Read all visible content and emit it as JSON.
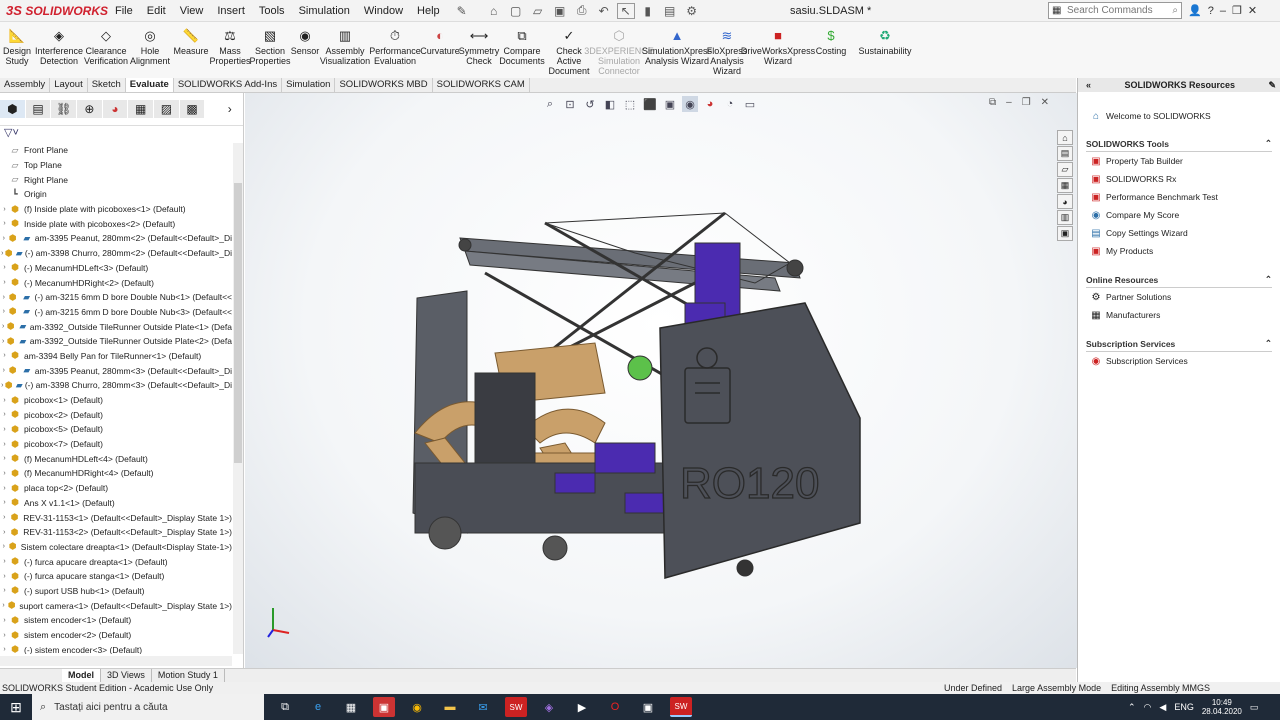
{
  "app": {
    "brand": "SOLIDWORKS",
    "menus": [
      "File",
      "Edit",
      "View",
      "Insert",
      "Tools",
      "Simulation",
      "Window",
      "Help"
    ],
    "doc_title": "sasiu.SLDASM *",
    "search_placeholder": "Search Commands",
    "help_label": "?"
  },
  "commands": [
    {
      "label": "Design Study",
      "icon": "design-study-icon"
    },
    {
      "label": "Interference Detection",
      "icon": "interference-icon"
    },
    {
      "label": "Clearance Verification",
      "icon": "clearance-icon"
    },
    {
      "label": "Hole Alignment",
      "icon": "hole-alignment-icon"
    },
    {
      "label": "Measure",
      "icon": "measure-icon"
    },
    {
      "label": "Mass Properties",
      "icon": "mass-properties-icon"
    },
    {
      "label": "Section Properties",
      "icon": "section-properties-icon"
    },
    {
      "label": "Sensor",
      "icon": "sensor-icon"
    },
    {
      "label": "Assembly Visualization",
      "icon": "assembly-visualization-icon"
    },
    {
      "label": "Performance Evaluation",
      "icon": "performance-icon"
    },
    {
      "label": "Curvature",
      "icon": "curvature-icon"
    },
    {
      "label": "Symmetry Check",
      "icon": "symmetry-icon"
    },
    {
      "label": "Compare Documents",
      "icon": "compare-icon"
    },
    {
      "label": "Check Active Document",
      "icon": "check-icon"
    },
    {
      "label": "3DEXPERIENCE Simulation Connector",
      "icon": "connector-icon",
      "disabled": true
    },
    {
      "label": "SimulationXpress Analysis Wizard",
      "icon": "simxpress-icon"
    },
    {
      "label": "FloXpress Analysis Wizard",
      "icon": "floxpress-icon"
    },
    {
      "label": "DriveWorksXpress Wizard",
      "icon": "driveworks-icon"
    },
    {
      "label": "Costing",
      "icon": "costing-icon"
    },
    {
      "label": "Sustainability",
      "icon": "sustainability-icon"
    }
  ],
  "cmd_tabs": [
    "Assembly",
    "Layout",
    "Sketch",
    "Evaluate",
    "SOLIDWORKS Add-Ins",
    "Simulation",
    "SOLIDWORKS MBD",
    "SOLIDWORKS CAM"
  ],
  "active_cmd_tab": "Evaluate",
  "tree": [
    {
      "label": "Front Plane",
      "type": "plane"
    },
    {
      "label": "Top Plane",
      "type": "plane"
    },
    {
      "label": "Right Plane",
      "type": "plane"
    },
    {
      "label": "Origin",
      "type": "origin"
    },
    {
      "label": "(f) Inside plate with picoboxes<1> (Default)",
      "type": "asm"
    },
    {
      "label": "Inside plate with picoboxes<2> (Default)",
      "type": "asm"
    },
    {
      "label": "am-3395 Peanut, 280mm<2> (Default<<Default>_Di",
      "type": "asm-part"
    },
    {
      "label": "(-) am-3398 Churro, 280mm<2> (Default<<Default>_Di",
      "type": "asm-part"
    },
    {
      "label": "(-) MecanumHDLeft<3> (Default)",
      "type": "asm"
    },
    {
      "label": "(-) MecanumHDRight<2> (Default)",
      "type": "asm"
    },
    {
      "label": "(-) am-3215 6mm D bore Double Nub<1> (Default<<",
      "type": "asm-part"
    },
    {
      "label": "(-) am-3215 6mm D bore Double Nub<3> (Default<<",
      "type": "asm-part"
    },
    {
      "label": "am-3392_Outside TileRunner Outside Plate<1> (Defa",
      "type": "asm-part"
    },
    {
      "label": "am-3392_Outside TileRunner Outside Plate<2> (Defa",
      "type": "asm-part"
    },
    {
      "label": "am-3394 Belly Pan for TileRunner<1> (Default)",
      "type": "asm"
    },
    {
      "label": "am-3395 Peanut, 280mm<3> (Default<<Default>_Di",
      "type": "asm-part"
    },
    {
      "label": "(-) am-3398 Churro, 280mm<3> (Default<<Default>_Di",
      "type": "asm-part"
    },
    {
      "label": "picobox<1> (Default)",
      "type": "asm"
    },
    {
      "label": "picobox<2> (Default)",
      "type": "asm"
    },
    {
      "label": "picobox<5> (Default)",
      "type": "asm"
    },
    {
      "label": "picobox<7> (Default)",
      "type": "asm"
    },
    {
      "label": "(f) MecanumHDLeft<4> (Default)",
      "type": "asm"
    },
    {
      "label": "(f) MecanumHDRight<4> (Default)",
      "type": "asm"
    },
    {
      "label": "placa top<2> (Default)",
      "type": "asm"
    },
    {
      "label": "Ans X v1.1<1> (Default)",
      "type": "asm"
    },
    {
      "label": "REV-31-1153<1> (Default<<Default>_Display State 1>)",
      "type": "asm"
    },
    {
      "label": "REV-31-1153<2> (Default<<Default>_Display State 1>)",
      "type": "asm"
    },
    {
      "label": "Sistem colectare dreapta<1> (Default<Display State-1>)",
      "type": "asm"
    },
    {
      "label": "(-) furca apucare dreapta<1> (Default)",
      "type": "asm"
    },
    {
      "label": "(-) furca apucare stanga<1> (Default)",
      "type": "asm"
    },
    {
      "label": "(-) suport USB hub<1> (Default)",
      "type": "asm"
    },
    {
      "label": "suport camera<1> (Default<<Default>_Display State 1>)",
      "type": "asm"
    },
    {
      "label": "sistem encoder<1> (Default)",
      "type": "asm"
    },
    {
      "label": "sistem encoder<2> (Default)",
      "type": "asm"
    },
    {
      "label": "(-) sistem encoder<3> (Default)",
      "type": "asm"
    }
  ],
  "bottom_tabs": [
    "Model",
    "3D Views",
    "Motion Study 1"
  ],
  "active_bottom_tab": "Model",
  "status": {
    "edition": "SOLIDWORKS Student Edition - Academic Use Only",
    "under_defined": "Under Defined",
    "mode": "Large Assembly Mode",
    "editing": "Editing Assembly",
    "units": "MMGS"
  },
  "robot_label": "RO120",
  "taskpane": {
    "title": "SOLIDWORKS Resources",
    "welcome": "Welcome to SOLIDWORKS",
    "sections": [
      {
        "title": "SOLIDWORKS Tools",
        "items": [
          "Property Tab Builder",
          "SOLIDWORKS Rx",
          "Performance Benchmark Test",
          "Compare My Score",
          "Copy Settings Wizard",
          "My Products"
        ]
      },
      {
        "title": "Online Resources",
        "items": [
          "Partner Solutions",
          "Manufacturers"
        ]
      },
      {
        "title": "Subscription Services",
        "items": [
          "Subscription Services"
        ]
      }
    ]
  },
  "taskbar": {
    "search_placeholder": "Tastați aici pentru a căuta",
    "lang": "ENG",
    "time": "10:49",
    "date": "28.04.2020"
  },
  "colors": {
    "brand_red": "#d0202e",
    "taskbar": "#1f2a38",
    "part_gray": "#4a4d55",
    "wood": "#c9a06a",
    "accent_purple": "#4b2bb0"
  }
}
